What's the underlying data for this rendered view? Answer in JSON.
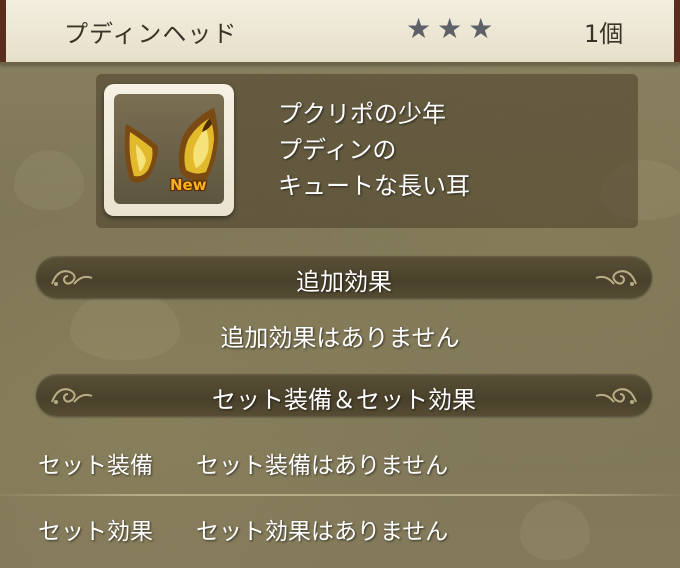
{
  "header": {
    "item_name": "プディンヘッド",
    "star_count": 3,
    "quantity": "1個"
  },
  "item": {
    "icon": "cat-ears-icon",
    "badge": "New",
    "description": [
      "プクリポの少年",
      "プディンの",
      "キュートな長い耳"
    ]
  },
  "sections": {
    "additional_effect": {
      "title": "追加効果",
      "text": "追加効果はありません"
    },
    "set": {
      "title": "セット装備＆セット効果",
      "rows": [
        {
          "label": "セット装備",
          "value": "セット装備はありません"
        },
        {
          "label": "セット効果",
          "value": "セット効果はありません"
        }
      ]
    }
  },
  "colors": {
    "header_bg": "#ece6d3",
    "star": "#5e6268",
    "badge": "#f7b21f",
    "section_bar": "#4f462f",
    "ear_gold": "#e2b92a",
    "ear_brown": "#7a4a12"
  }
}
